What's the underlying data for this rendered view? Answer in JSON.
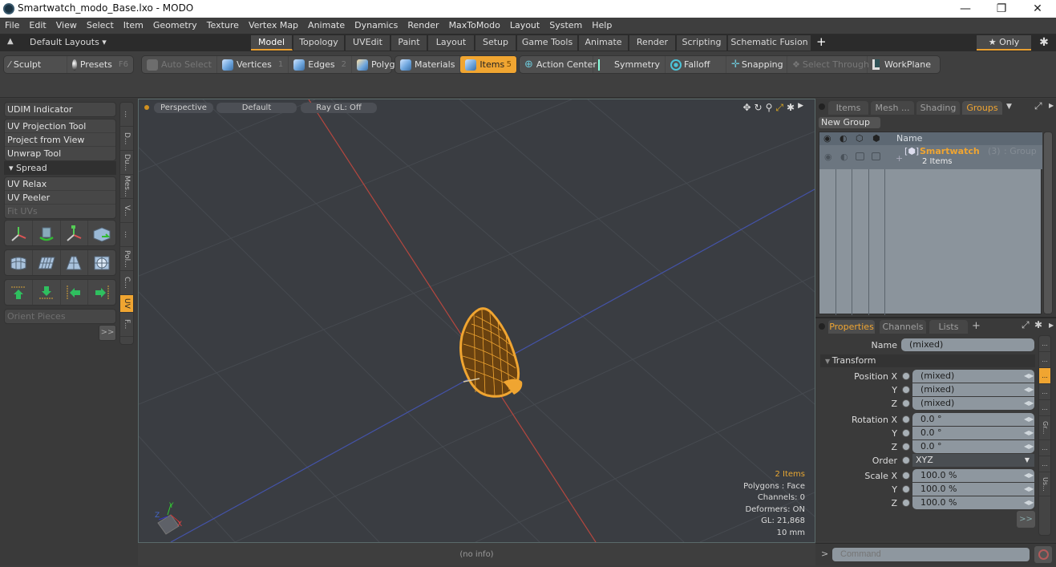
{
  "window": {
    "title": "Smartwatch_modo_Base.lxo - MODO",
    "controls": {
      "minimize": "—",
      "restore": "❐",
      "close": "✕"
    }
  },
  "menu": [
    "File",
    "Edit",
    "View",
    "Select",
    "Item",
    "Geometry",
    "Texture",
    "Vertex Map",
    "Animate",
    "Dynamics",
    "Render",
    "MaxToModo",
    "Layout",
    "System",
    "Help"
  ],
  "layouts": {
    "label": "Default Layouts ▾",
    "tabs": [
      "Model",
      "Topology",
      "UVEdit",
      "Paint",
      "Layout",
      "Setup",
      "Game Tools",
      "Animate",
      "Render",
      "Scripting",
      "Schematic Fusion"
    ],
    "active": "Model",
    "add": "+",
    "only": "★ Only",
    "gear": "✱"
  },
  "toolbar": {
    "sculpt": "Sculpt",
    "presets": "Presets",
    "presets_key": "F6",
    "auto_select": "Auto Select",
    "vertices": "Vertices",
    "vertices_key": "1",
    "edges": "Edges",
    "edges_key": "2",
    "polygons": "Polygons",
    "materials": "Materials",
    "items": "Items",
    "items_key": "5",
    "action_center": "Action Center",
    "symmetry": "Symmetry",
    "falloff": "Falloff",
    "snapping": "Snapping",
    "select_through": "Select Through",
    "workplane": "WorkPlane"
  },
  "left_panel": {
    "udim": "UDIM Indicator",
    "tools1": [
      "UV Projection Tool",
      "Project from View",
      "Unwrap Tool"
    ],
    "spread_header": "▾ Spread",
    "tools2": [
      "UV Relax",
      "UV Peeler",
      "Fit UVs"
    ],
    "orient": "Orient Pieces",
    "expand": ">>",
    "vtabs": [
      "...",
      "D...",
      "Du...",
      "Mes...",
      "V...",
      "...",
      "Pol...",
      "C...",
      "UV",
      "F..."
    ],
    "active_vtab": "UV"
  },
  "viewport": {
    "view": "Perspective",
    "shading": "Default",
    "raygl": "Ray GL: Off",
    "stats": {
      "items": "2 Items",
      "polygons": "Polygons : Face",
      "channels": "Channels: 0",
      "deformers": "Deformers: ON",
      "gl": "GL: 21,868",
      "grid": "10 mm"
    },
    "axis_labels": {
      "x": "X",
      "y": "Y",
      "z": "Z"
    },
    "colors": {
      "x_axis": "#b5473f",
      "z_axis": "#4453a8",
      "selection": "#f0a531"
    }
  },
  "status": "(no info)",
  "groups_panel": {
    "tabs": [
      "Items",
      "Mesh ...",
      "Shading",
      "Groups"
    ],
    "active": "Groups",
    "new_group": "New Group",
    "column_name": "Name",
    "row": {
      "name": "Smartwatch",
      "count": "(3)",
      "type": ": Group",
      "sub": "2 Items"
    }
  },
  "properties_panel": {
    "tabs": [
      "Properties",
      "Channels",
      "Lists"
    ],
    "active": "Properties",
    "add": "+",
    "name_label": "Name",
    "name_value": "(mixed)",
    "section": "Transform",
    "position": [
      {
        "label": "Position X",
        "value": "(mixed)"
      },
      {
        "label": "Y",
        "value": "(mixed)"
      },
      {
        "label": "Z",
        "value": "(mixed)"
      }
    ],
    "rotation": [
      {
        "label": "Rotation X",
        "value": "0.0 °"
      },
      {
        "label": "Y",
        "value": "0.0 °"
      },
      {
        "label": "Z",
        "value": "0.0 °"
      }
    ],
    "order_label": "Order",
    "order_value": "XYZ",
    "scale": [
      {
        "label": "Scale X",
        "value": "100.0 %"
      },
      {
        "label": "Y",
        "value": "100.0 %"
      },
      {
        "label": "Z",
        "value": "100.0 %"
      }
    ],
    "expand": ">>",
    "vtabs": [
      "...",
      "...",
      "...",
      "...",
      "...",
      "Gr...",
      "...",
      "...",
      "Us..."
    ]
  },
  "command": {
    "prompt": ">",
    "placeholder": "Command"
  }
}
